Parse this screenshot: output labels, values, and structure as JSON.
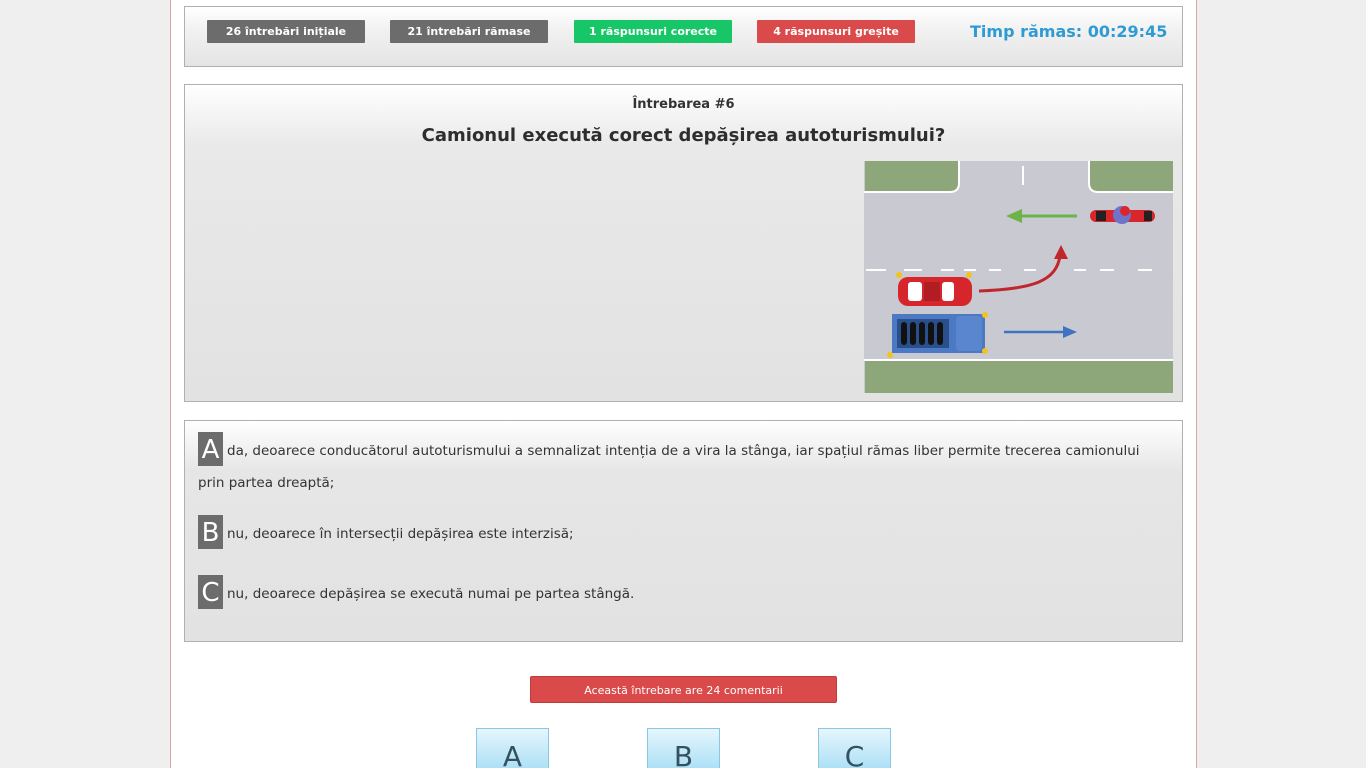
{
  "stats": {
    "initial": "26 întrebări inițiale",
    "remaining": "21 întrebări rămase",
    "correct": "1 răspunsuri corecte",
    "wrong": "4 răspunsuri greșite",
    "timer": "Timp rămas: 00:29:45"
  },
  "question": {
    "number": "Întrebarea #6",
    "text": "Camionul execută corect depășirea autoturismului?"
  },
  "answers": [
    {
      "letter": "A",
      "text": "da, deoarece conducătorul autoturismului a semnalizat intenția de a vira la stânga, iar spațiul rămas liber permite trecerea camionului prin partea dreaptă;"
    },
    {
      "letter": "B",
      "text": "nu, deoarece în intersecții depășirea este interzisă;"
    },
    {
      "letter": "C",
      "text": "nu, deoarece depășirea se execută numai pe partea stângă."
    }
  ],
  "comments_button": "Această întrebare are 24 comentarii",
  "choice_buttons": [
    "A",
    "B",
    "C"
  ],
  "colors": {
    "gray_badge": "#6c6c6c",
    "green_badge": "#17c767",
    "red_badge": "#db4a4a",
    "timer": "#2f9bd3"
  }
}
